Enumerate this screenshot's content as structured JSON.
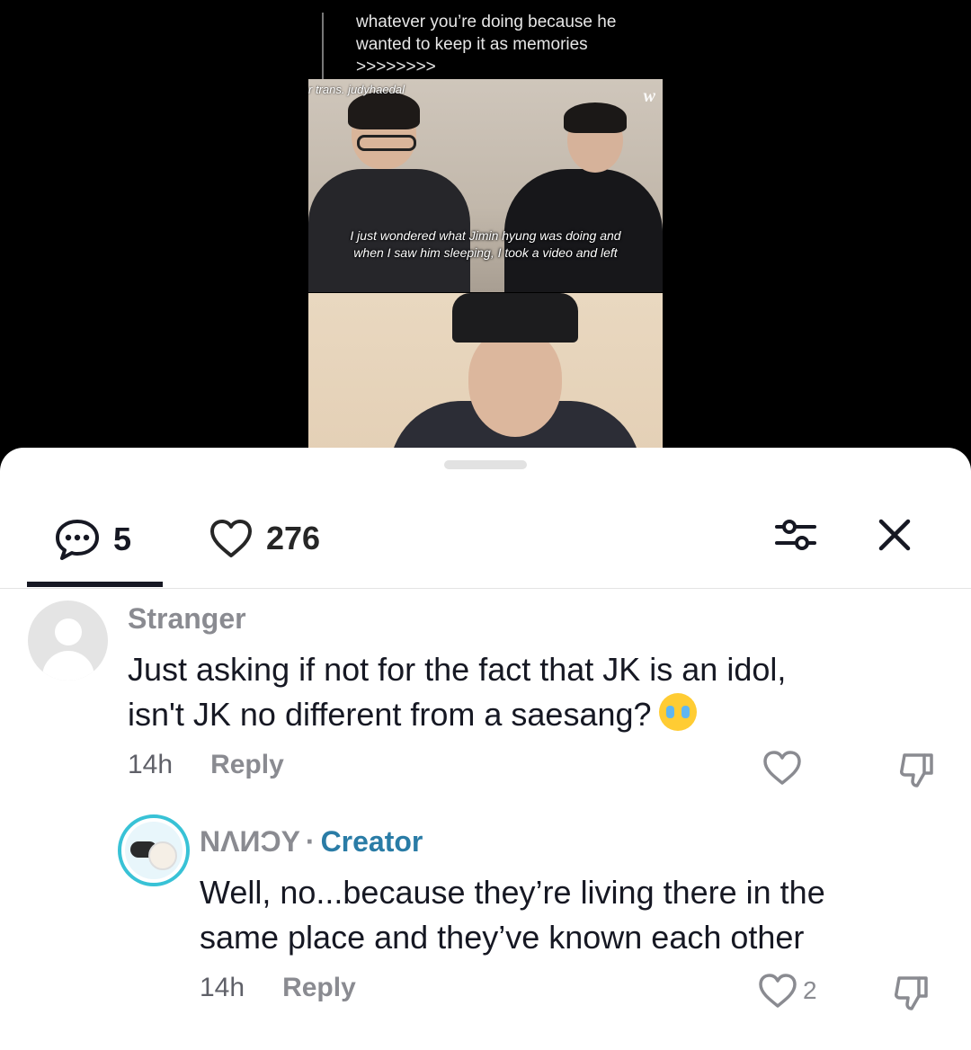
{
  "post": {
    "quote_lines": [
      "whatever you’re doing because he",
      "wanted to keep it as memories",
      ">>>>>>>>"
    ],
    "trans_credit": "r trans. judyhaedal",
    "watermark": "w",
    "subtitle_lines": [
      "I just wondered what Jimin hyung was doing and",
      "when I saw him sleeping, I took a video and left"
    ]
  },
  "stats": {
    "comments_count": "5",
    "likes_count": "276"
  },
  "comments": [
    {
      "username": "Stranger",
      "text_lines": [
        "Just asking if not for the fact that JK is an idol,",
        "isn't JK no different from a saesang?"
      ],
      "emoji": "crying-face",
      "time": "14h",
      "reply_label": "Reply",
      "likes": ""
    },
    {
      "username": "NΛИϽY",
      "separator": "·",
      "badge": "Creator",
      "text_lines": [
        "Well, no...because they’re living there in the",
        "same place and they’ve known each other"
      ],
      "time": "14h",
      "reply_label": "Reply",
      "likes": "2"
    }
  ],
  "colors": {
    "creator_accent": "#2a7ca6",
    "avatar_ring": "#38c2d6",
    "muted_text": "#8a8b91",
    "primary_text": "#161823"
  }
}
